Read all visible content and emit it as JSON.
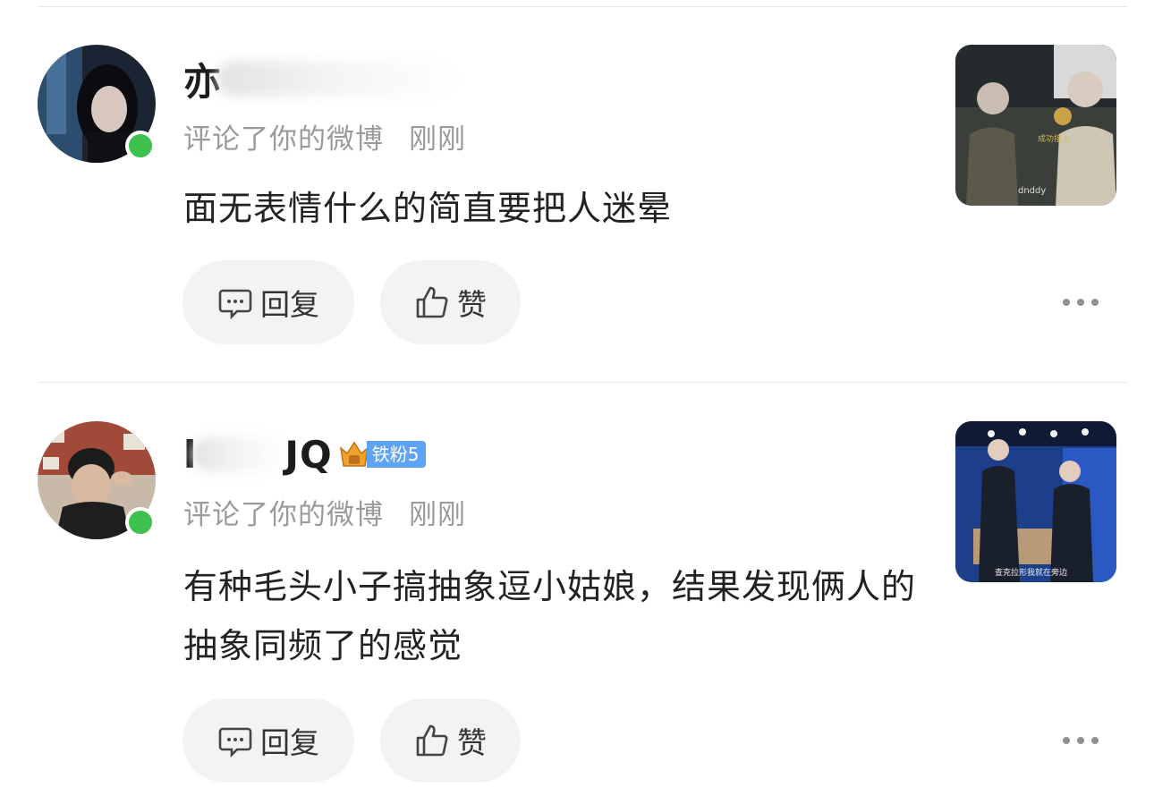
{
  "comments": [
    {
      "username": "亦",
      "action": "评论了你的微博",
      "time": "刚刚",
      "content": "面无表情什么的简直要把人迷晕",
      "reply_label": "回复",
      "like_label": "赞",
      "online": true,
      "thumbnail_caption": "dnddy"
    },
    {
      "username": "l",
      "username_tail": "JQ",
      "fan_badge": "铁粉5",
      "action": "评论了你的微博",
      "time": "刚刚",
      "content": "有种毛头小子搞抽象逗小姑娘，结果发现俩人的抽象同频了的感觉",
      "reply_label": "回复",
      "like_label": "赞",
      "online": true
    }
  ],
  "colors": {
    "online": "#3fc14f",
    "fan_badge": "#5ea3f6",
    "meta_text": "#9a9a9a",
    "pill_bg": "#f3f3f3"
  },
  "icons": {
    "reply": "comment-bubble-icon",
    "like": "thumbs-up-icon",
    "more": "more-dots-icon"
  }
}
